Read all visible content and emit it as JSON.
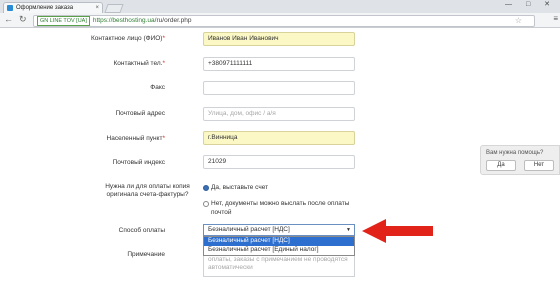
{
  "browser": {
    "tab_title": "Оформление заказа",
    "tab_close": "×",
    "window_controls": "— □ ✕",
    "secure_badge": "GN LINE TOV [UA]",
    "url_host": "https://besthosting.ua",
    "url_path": "/ru/order.php"
  },
  "form": {
    "contact_label": "Контактное лицо (ФИО)",
    "contact_value": "Иванов Иван Иванович",
    "phone_label": "Контактный тел.",
    "phone_value": "+380971111111",
    "fax_label": "Факс",
    "fax_value": "",
    "address_label": "Почтовый адрес",
    "address_placeholder": "Улица, дом, офис / а/я",
    "city_label": "Населенный пункт",
    "city_value": "г.Винница",
    "zip_label": "Почтовый индекс",
    "zip_value": "21029",
    "invoice_label": "Нужна ли для оплаты копия оригинала счета-фактуры?",
    "invoice_yes": "Да, выставьте счет",
    "invoice_no": "Нет, документы можно выслать после оплаты почтой",
    "payment_label": "Способ оплаты",
    "payment_selected": "Безналичный расчет [НДС]",
    "payment_options": [
      "Безналичный расчет [НДС]",
      "Безналичный расчет [Единый налог]"
    ],
    "note_label": "Примечание",
    "note_placeholder": "оплаты, заказы с примечанием не проводятся автоматически"
  },
  "help": {
    "question": "Вам нужна помощь?",
    "yes": "Да",
    "no": "Нет"
  },
  "colors": {
    "arrow": "#e2231a",
    "required_field_bg": "#fbf8c6",
    "selected_option": "#2d6fce"
  }
}
